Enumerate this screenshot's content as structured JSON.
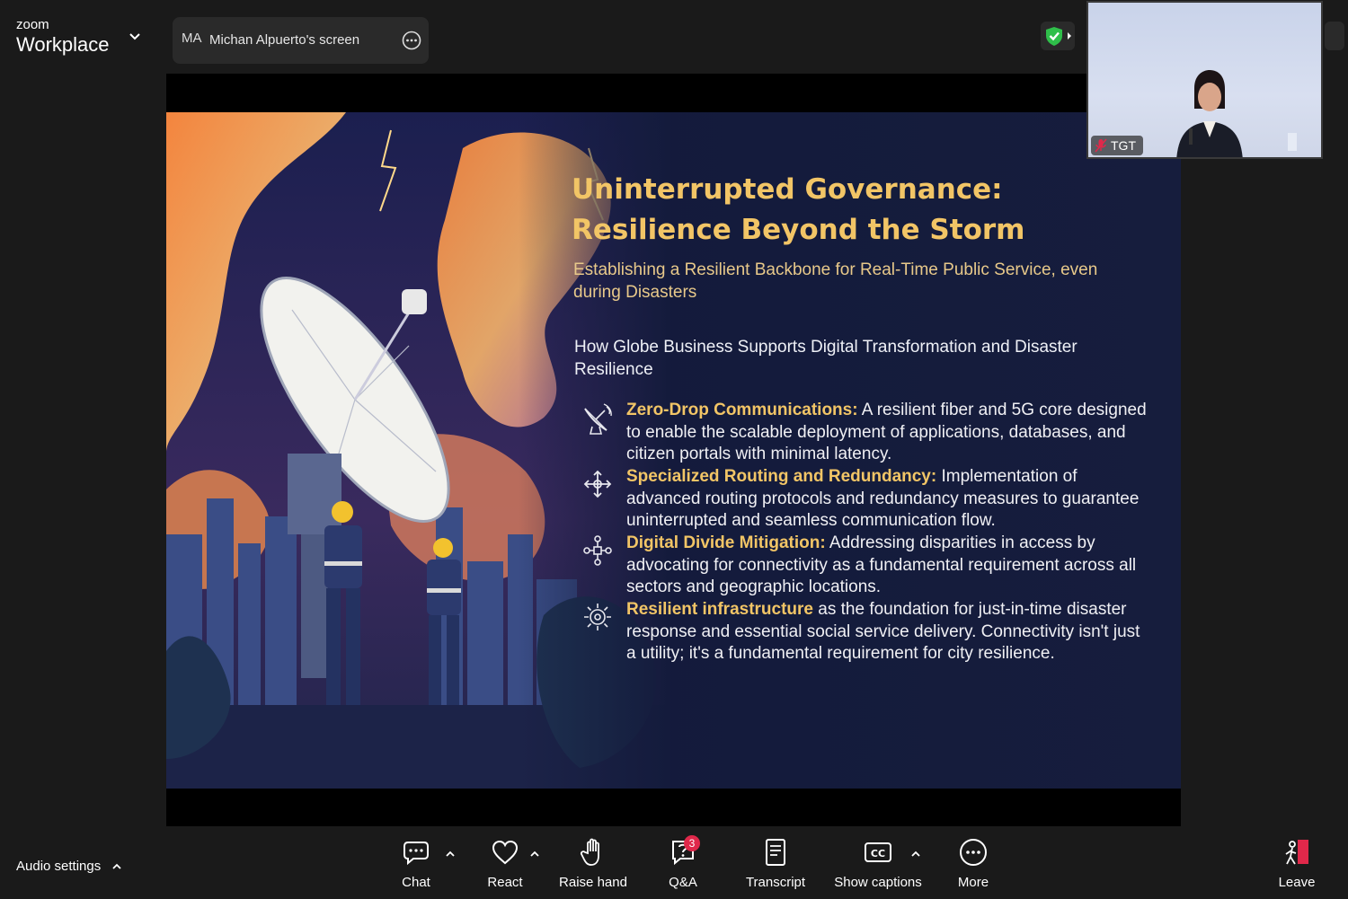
{
  "app": {
    "brand_top": "zoom",
    "brand_bottom": "Workplace"
  },
  "share": {
    "avatar_initials": "MA",
    "title": "Michan Alpuerto's screen"
  },
  "slide": {
    "title_line1": "Uninterrupted Governance:",
    "title_line2": "Resilience Beyond the Storm",
    "subtitle": "Establishing a Resilient Backbone for Real-Time Public Service, even during Disasters",
    "intro": "How Globe Business Supports Digital Transformation and Disaster Resilience",
    "points": [
      {
        "icon": "satellite-dish-icon",
        "heading": "Zero-Drop Communications:",
        "body": " A resilient fiber and 5G core designed to enable the scalable deployment of applications, databases, and citizen portals with minimal latency."
      },
      {
        "icon": "routing-arrows-icon",
        "heading": "Specialized Routing and Redundancy:",
        "body": " Implementation of advanced routing protocols and redundancy measures to guarantee uninterrupted and seamless communication flow."
      },
      {
        "icon": "network-people-icon",
        "heading": "Digital Divide Mitigation:",
        "body": " Addressing disparities in access by advocating for connectivity as a fundamental requirement across all sectors and geographic locations."
      },
      {
        "icon": "infrastructure-gear-icon",
        "heading": "Resilient infrastructure",
        "body": " as the foundation for just-in-time disaster response and essential social service delivery. Connectivity isn't just a utility; it's a fundamental requirement for city resilience."
      }
    ]
  },
  "self_view": {
    "name": "TGT",
    "mic_state": "muted"
  },
  "toolbar": {
    "audio_settings": "Audio settings",
    "chat": "Chat",
    "react": "React",
    "raise_hand": "Raise hand",
    "qa": "Q&A",
    "qa_badge": "3",
    "transcript": "Transcript",
    "show_captions": "Show captions",
    "more": "More",
    "leave": "Leave"
  },
  "colors": {
    "accent_gold": "#f2c566",
    "leave_red": "#e0284a",
    "shield_green": "#2fbf4a"
  }
}
